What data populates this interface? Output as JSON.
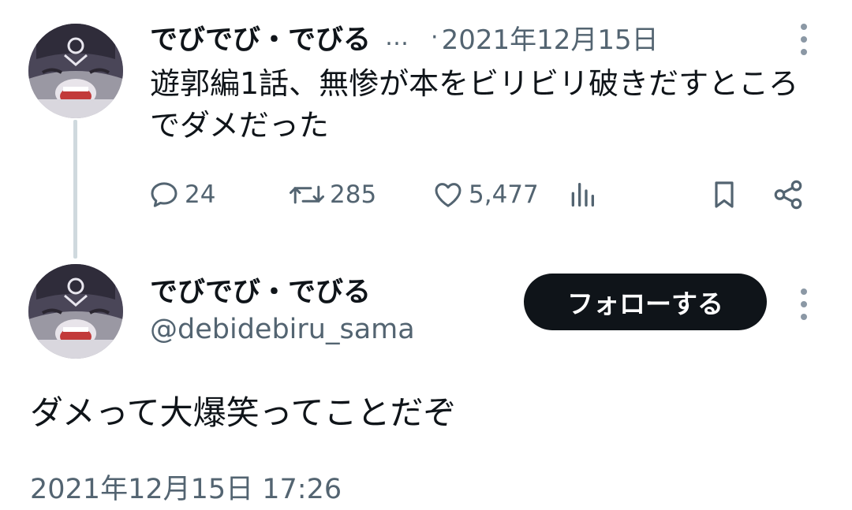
{
  "parent_tweet": {
    "display_name": "でびでび・でびる",
    "name_truncation": "…",
    "separator": "·",
    "date": "2021年12月15日",
    "text": "遊郭編1話、無惨が本をビリビリ破きだすところでダメだった",
    "actions": {
      "reply_count": "24",
      "retweet_count": "285",
      "like_count": "5,477"
    },
    "icons": [
      "more-icon",
      "reply-icon",
      "retweet-icon",
      "like-icon",
      "views-icon",
      "bookmark-icon",
      "share-icon"
    ]
  },
  "main_tweet": {
    "display_name": "でびでび・でびる",
    "handle": "@debidebiru_sama",
    "follow_label": "フォローする",
    "text": "ダメって大爆笑ってことだぞ",
    "timestamp": "2021年12月15日 17:26"
  },
  "colors": {
    "text_primary": "#0f1419",
    "text_secondary": "#536471",
    "thread_line": "#cfd9de",
    "follow_button": "#0f1419"
  }
}
